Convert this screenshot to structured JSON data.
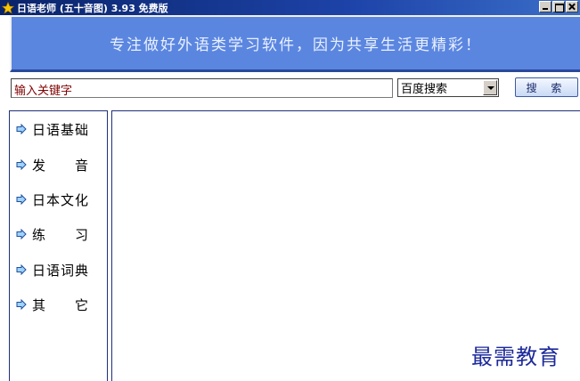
{
  "window": {
    "title": "日语老师 (五十音图) 3.93 免费版",
    "icon": "star-icon",
    "title_bar_color": "#0a246a"
  },
  "banner": {
    "slogan": "专注做好外语类学习软件，因为共享生活更精彩！",
    "background_color": "#5b86e0"
  },
  "search": {
    "input_value": "输入关键字",
    "engine_selected": "百度搜索",
    "button_label": "搜 索"
  },
  "sidebar": {
    "items": [
      {
        "label": "日语基础",
        "icon": "arrow-right-icon"
      },
      {
        "label": "发　　音",
        "icon": "arrow-right-icon"
      },
      {
        "label": "日本文化",
        "icon": "arrow-right-icon"
      },
      {
        "label": "练　　习",
        "icon": "arrow-right-icon"
      },
      {
        "label": "日语词典",
        "icon": "arrow-right-icon"
      },
      {
        "label": "其　　它",
        "icon": "arrow-right-icon"
      }
    ]
  },
  "watermark": {
    "text": "最需教育"
  }
}
